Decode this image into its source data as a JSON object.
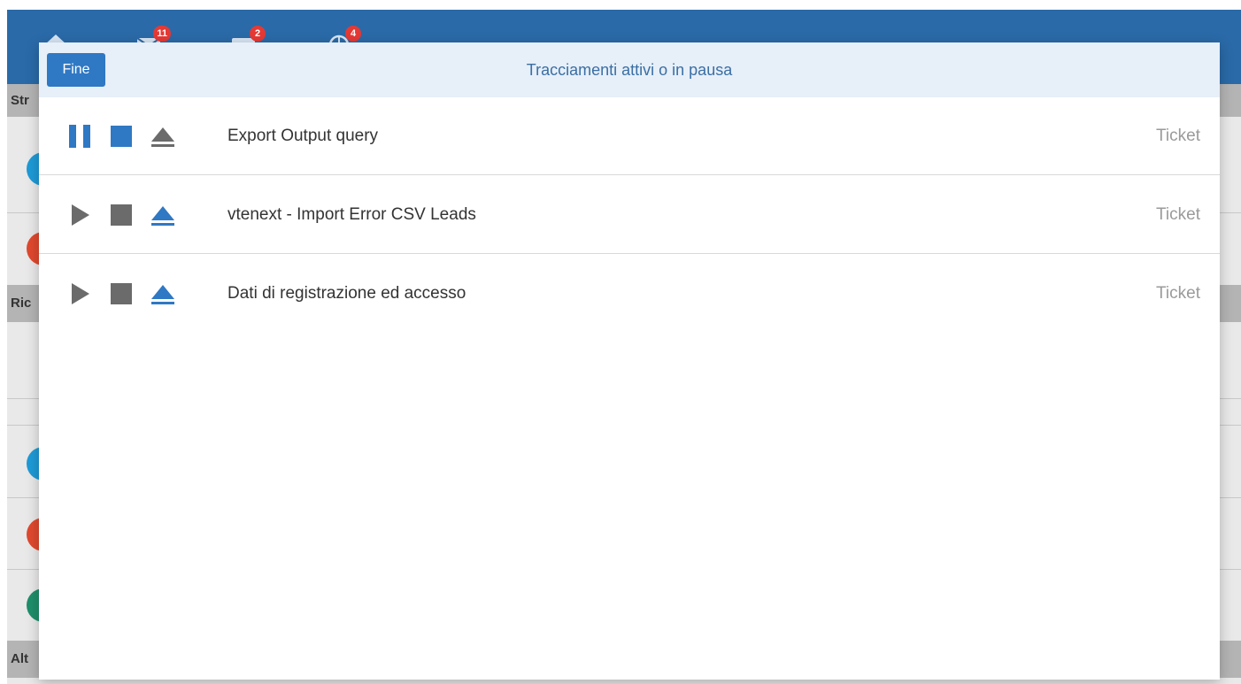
{
  "background": {
    "topbar_badges": [
      {
        "icon": "mail-icon",
        "count": "11"
      },
      {
        "icon": "message-icon",
        "count": "2"
      },
      {
        "icon": "globe-icon",
        "count": "4"
      }
    ],
    "sections": [
      "Str",
      "Ric",
      "Alt"
    ]
  },
  "modal": {
    "done_label": "Fine",
    "title": "Tracciamenti attivi o in pausa",
    "rows": [
      {
        "name": "Export Output query",
        "module": "Ticket",
        "state": "running"
      },
      {
        "name": "vtenext - Import Error CSV Leads",
        "module": "Ticket",
        "state": "paused"
      },
      {
        "name": "Dati di registrazione ed accesso",
        "module": "Ticket",
        "state": "paused"
      }
    ]
  },
  "colors": {
    "header_bar": "#2a6aa8",
    "accent": "#2f78c4",
    "inactive": "#6b6b6b"
  }
}
